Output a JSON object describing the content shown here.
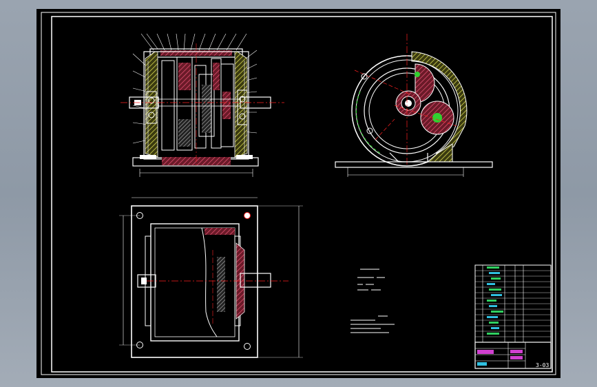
{
  "drawing": {
    "background": "#000000",
    "line_color": "#ffffff",
    "centerline_color": "#ff2020",
    "section_hatch_color": "#c0405a",
    "casing_hatch_color": "#d8d850",
    "title_accent_color": "#d040d0",
    "cyan_text_color": "#30c0e0",
    "green_color": "#30d030"
  },
  "title_block": {
    "drawing_number": "3-03"
  }
}
